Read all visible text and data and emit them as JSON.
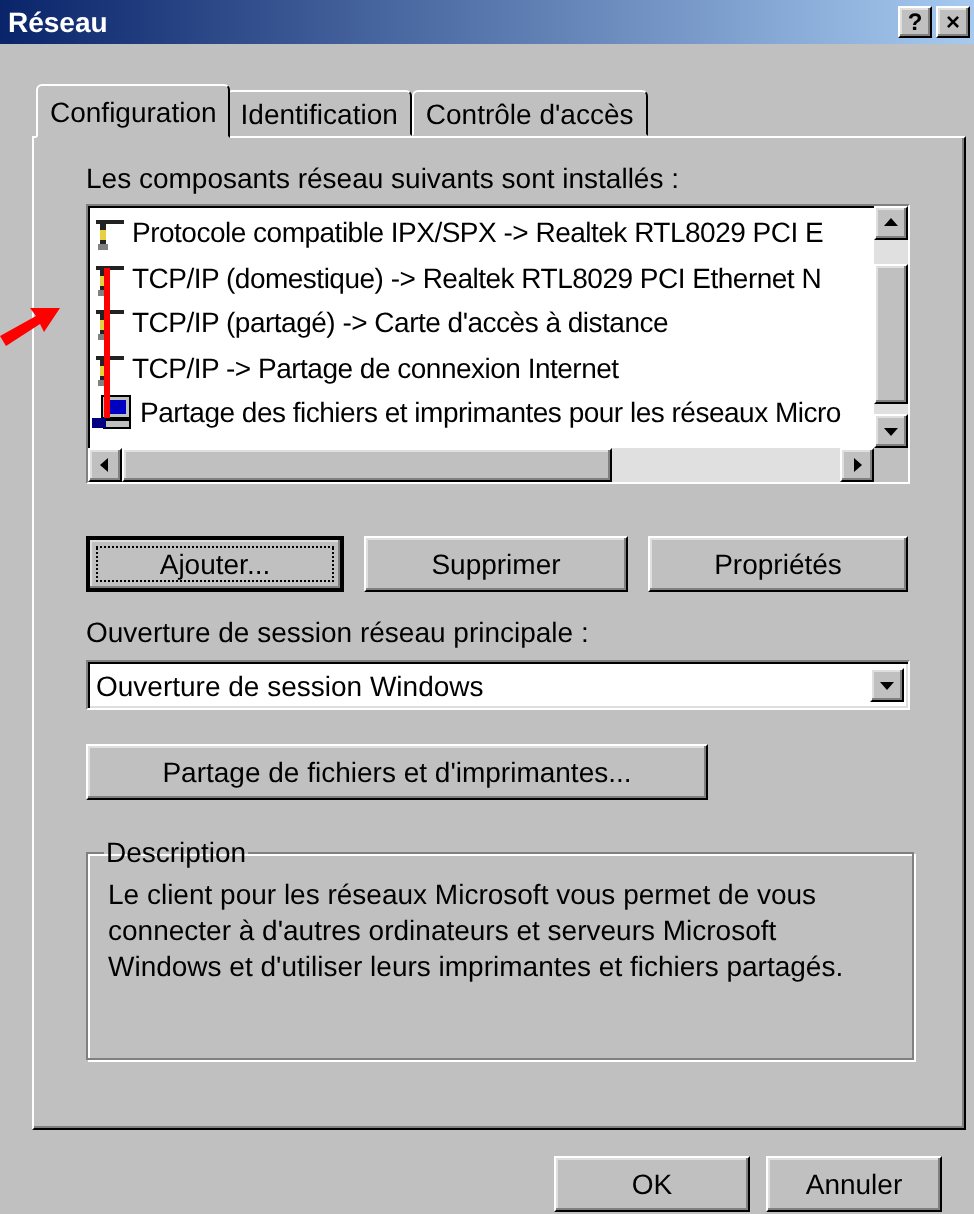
{
  "window": {
    "title": "Réseau",
    "title_buttons": [
      "?",
      "×"
    ]
  },
  "tabs": [
    {
      "label": "Configuration",
      "selected": true
    },
    {
      "label": "Identification",
      "selected": false
    },
    {
      "label": "Contrôle d'accès",
      "selected": false
    }
  ],
  "components": {
    "label": "Les composants réseau suivants sont installés :",
    "items": [
      {
        "kind": "protocol",
        "text": "Protocole compatible IPX/SPX -> Realtek RTL8029 PCI E"
      },
      {
        "kind": "protocol",
        "text": "TCP/IP (domestique) -> Realtek RTL8029 PCI Ethernet N"
      },
      {
        "kind": "protocol",
        "text": "TCP/IP (partagé) -> Carte d'accès à distance"
      },
      {
        "kind": "protocol",
        "text": "TCP/IP -> Partage de connexion Internet"
      },
      {
        "kind": "service",
        "text": "Partage des fichiers et imprimantes pour les réseaux Micro"
      }
    ]
  },
  "component_buttons": [
    {
      "label": "Ajouter...",
      "focused": true
    },
    {
      "label": "Supprimer",
      "focused": false
    },
    {
      "label": "Propriétés",
      "focused": false
    }
  ],
  "logon": {
    "label": "Ouverture de session réseau principale :",
    "value": "Ouverture de session Windows"
  },
  "sharing_button": "Partage de fichiers et d'imprimantes...",
  "description": {
    "title": "Description",
    "text": "Le client pour les réseaux Microsoft vous permet de vous connecter à d'autres ordinateurs et serveurs Microsoft Windows et d'utiliser leurs imprimantes et fichiers partagés."
  },
  "dialog_buttons": [
    "OK",
    "Annuler"
  ]
}
